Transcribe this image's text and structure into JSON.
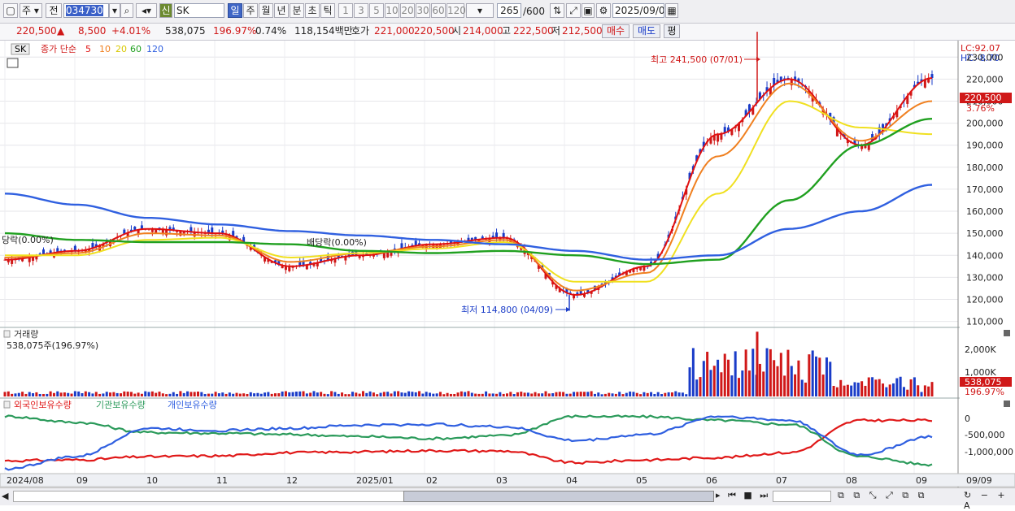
{
  "toolbar": {
    "period_type": "주",
    "prev_label": "전",
    "code": "034730",
    "stock_name": "SK",
    "new_label": "신",
    "periods": [
      "일",
      "주",
      "월",
      "년",
      "분",
      "초",
      "틱"
    ],
    "selected_period": "일",
    "intervals": [
      "1",
      "3",
      "5",
      "10",
      "20",
      "30",
      "60",
      "120"
    ],
    "count": "265",
    "count_max": "/600",
    "date": "2025/09/09"
  },
  "quote": {
    "price": "220,500",
    "arrow": "▲",
    "change": "8,500",
    "change_pct": "+4.01%",
    "volume": "538,075",
    "volume_ratio": "196.97%",
    "turnover": "0.74%",
    "amount": "118,154백만",
    "bid_label": "호가",
    "bid1": "221,000",
    "bid2": "220,500",
    "open_label": "시",
    "open": "214,000",
    "high_label": "고",
    "high": "222,500",
    "low_label": "저",
    "low": "212,500",
    "buy_label": "매수",
    "sell_label": "매도",
    "eval_label": "평"
  },
  "price_panel": {
    "name_tag": "SK",
    "ma_title": "종가 단순",
    "ma_periods": [
      "5",
      "10",
      "20",
      "60",
      "120"
    ],
    "lc_label": "LC:92.07",
    "hc_label": "HC:-8.70",
    "high_annotation": "최고 241,500 (07/01)",
    "low_annotation": "최저 114,800 (04/09)",
    "dividend_left": "당락(0.00%)",
    "dividend_mid": "배당락(0.00%)",
    "current_price_tag": "220,500",
    "current_pct_tag": "3.76%",
    "axis_ticks": [
      "230,000",
      "220,000",
      "210,000",
      "200,000",
      "190,000",
      "180,000",
      "170,000",
      "160,000",
      "150,000",
      "140,000",
      "130,000",
      "120,000",
      "110,000"
    ]
  },
  "volume_panel": {
    "title": "거래량",
    "value_text": "538,075주(196.97%)",
    "axis_ticks": [
      "2,000K",
      "1,000K"
    ],
    "current_tag": "538,075",
    "current_pct_tag": "196.97%"
  },
  "holding_panel": {
    "legend": [
      "외국인보유수량",
      "기관보유수량",
      "개인보유수량"
    ],
    "axis_ticks": [
      "0",
      "-500,000",
      "-1,000,000"
    ]
  },
  "x_axis": {
    "labels": [
      "2024/08",
      "09",
      "10",
      "11",
      "12",
      "2025/01",
      "02",
      "03",
      "04",
      "05",
      "06",
      "07",
      "08",
      "09"
    ],
    "end_label": "09/09"
  },
  "colors": {
    "up": "#d01818",
    "down": "#1a3cc8",
    "ma5": "#e01010",
    "ma10": "#f08020",
    "ma20": "#f0e020",
    "ma60": "#20a020",
    "ma120": "#3060e0",
    "foreign": "#e01818",
    "institution": "#2a9a5a",
    "individual": "#2f5fe0"
  },
  "chart_data": {
    "type": "line",
    "title": "SK",
    "x": [
      "2024/08",
      "09",
      "10",
      "11",
      "12",
      "2025/01",
      "02",
      "03",
      "04",
      "05",
      "06",
      "07",
      "08",
      "09/09"
    ],
    "series": [
      {
        "name": "5",
        "values": [
          138000,
          142000,
          152000,
          150000,
          135000,
          140000,
          145000,
          148000,
          122000,
          135000,
          195000,
          220000,
          190000,
          220500
        ]
      },
      {
        "name": "10",
        "values": [
          139000,
          141000,
          150000,
          149000,
          137000,
          141000,
          144000,
          147000,
          124000,
          132000,
          185000,
          218000,
          192000,
          210000
        ]
      },
      {
        "name": "20",
        "values": [
          140000,
          140000,
          147000,
          148000,
          139000,
          141000,
          143000,
          146000,
          128000,
          128000,
          168000,
          210000,
          198000,
          195000
        ]
      },
      {
        "name": "60",
        "values": [
          150000,
          147000,
          146000,
          146000,
          145000,
          142000,
          141000,
          142000,
          140000,
          136000,
          138000,
          165000,
          190000,
          202000
        ]
      },
      {
        "name": "120",
        "values": [
          168000,
          163000,
          157000,
          154000,
          151000,
          149000,
          147000,
          145000,
          142000,
          138000,
          140000,
          152000,
          160000,
          172000
        ]
      }
    ],
    "price_high": 241500,
    "price_low": 114800,
    "last_close": 220500,
    "ylim": [
      108000,
      236000
    ],
    "volume_series": {
      "name": "거래량",
      "last": 538075,
      "ylim": [
        0,
        2500000
      ]
    },
    "holding_series": [
      {
        "name": "외국인보유수량",
        "values": [
          -1100000,
          -1080000,
          -1000000,
          -980000,
          -900000,
          -880000,
          -850000,
          -860000,
          -1150000,
          -1080000,
          -1020000,
          -900000,
          -100000,
          -100000
        ]
      },
      {
        "name": "기관보유수량",
        "values": [
          0,
          -150000,
          -400000,
          -420000,
          -450000,
          -500000,
          -550000,
          -480000,
          0,
          -10000,
          -100000,
          -200000,
          -1000000,
          -1200000
        ]
      },
      {
        "name": "개인보유수량",
        "values": [
          -1300000,
          -1000000,
          -300000,
          -350000,
          -300000,
          -220000,
          -200000,
          -260000,
          -600000,
          -450000,
          0,
          -100000,
          -950000,
          -500000
        ]
      }
    ],
    "holding_ylim": [
      -1400000,
      250000
    ]
  }
}
